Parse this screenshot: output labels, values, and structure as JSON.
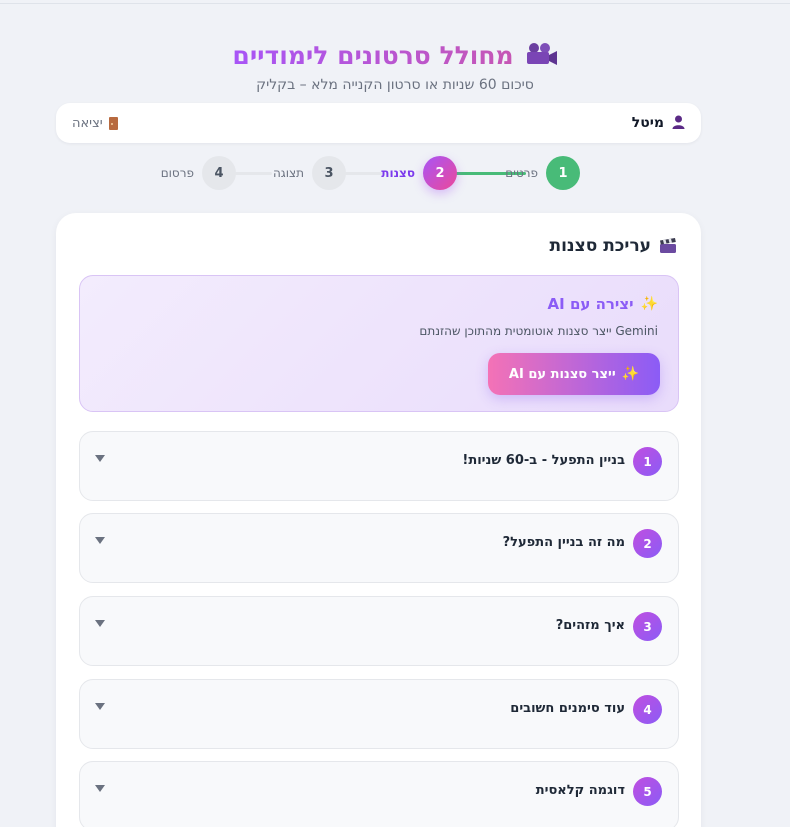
{
  "header": {
    "title": "מחולל סרטונים לימודיים",
    "title_icon": "movie-camera-icon",
    "subtitle": "סיכום 60 שניות או סרטון הקנייה מלא – בקליק"
  },
  "user": {
    "name": "מיטל",
    "user_icon": "person-icon",
    "logout_label": "יציאה",
    "logout_icon": "door-icon"
  },
  "steps": [
    {
      "number": "1",
      "label": "פרטים",
      "state": "done"
    },
    {
      "number": "2",
      "label": "סצנות",
      "state": "active"
    },
    {
      "number": "3",
      "label": "תצוגה",
      "state": "pending"
    },
    {
      "number": "4",
      "label": "פרסום",
      "state": "pending"
    }
  ],
  "editor": {
    "title": "עריכת סצנות",
    "title_icon": "clapperboard-icon",
    "ai": {
      "title": "יצירה עם AI",
      "description": "Gemini ייצר סצנות אוטומטית מהתוכן שהזנתם",
      "button_label": "ייצר סצנות עם AI",
      "icon": "sparkles-icon"
    },
    "scenes": [
      {
        "number": "1",
        "title": "בניין התפעל - ב-60 שניות!"
      },
      {
        "number": "2",
        "title": "מה זה בניין התפעל?"
      },
      {
        "number": "3",
        "title": "איך מזהים?"
      },
      {
        "number": "4",
        "title": "עוד סימנים חשובים"
      },
      {
        "number": "5",
        "title": "דוגמה קלאסית"
      }
    ]
  },
  "colors": {
    "accent_purple": "#8b5cf6",
    "accent_pink": "#ec4899",
    "done_green": "#48bb78",
    "background": "#f0f2f7"
  }
}
